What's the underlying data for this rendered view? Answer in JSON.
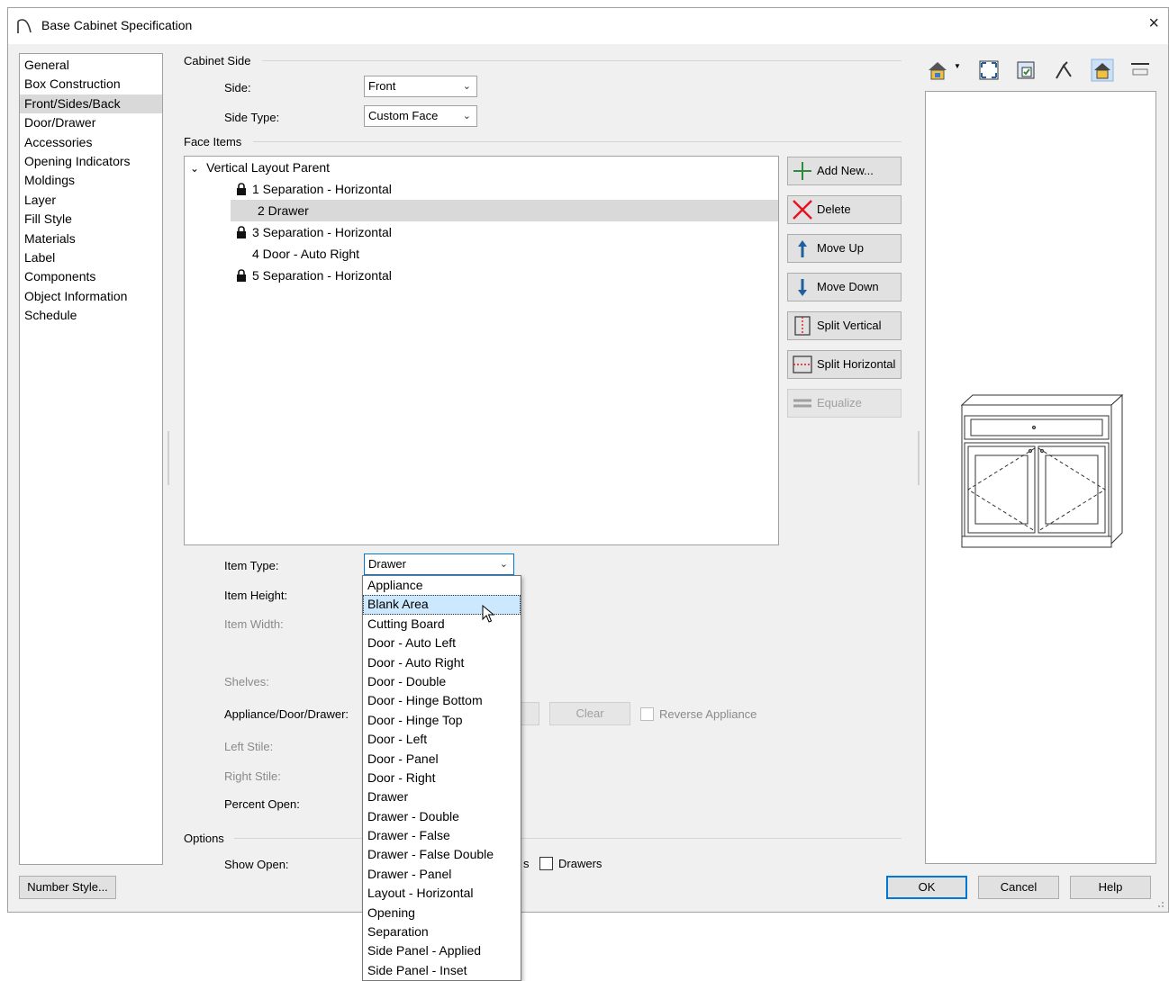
{
  "window": {
    "title": "Base Cabinet Specification",
    "close_glyph": "×"
  },
  "nav": {
    "items": [
      {
        "label": "General"
      },
      {
        "label": "Box Construction"
      },
      {
        "label": "Front/Sides/Back",
        "selected": true
      },
      {
        "label": "Door/Drawer"
      },
      {
        "label": "Accessories"
      },
      {
        "label": "Opening Indicators"
      },
      {
        "label": "Moldings"
      },
      {
        "label": "Layer"
      },
      {
        "label": "Fill Style"
      },
      {
        "label": "Materials"
      },
      {
        "label": "Label"
      },
      {
        "label": "Components"
      },
      {
        "label": "Object Information"
      },
      {
        "label": "Schedule"
      }
    ]
  },
  "cabinet_side": {
    "section": "Cabinet Side",
    "side_label": "Side:",
    "side_value": "Front",
    "side_type_label": "Side Type:",
    "side_type_value": "Custom Face"
  },
  "face_items": {
    "section": "Face Items",
    "tree": {
      "parent": "Vertical Layout Parent",
      "children": [
        {
          "label": "1 Separation - Horizontal",
          "locked": true
        },
        {
          "label": "2 Drawer",
          "locked": false,
          "selected": true
        },
        {
          "label": "3 Separation - Horizontal",
          "locked": true
        },
        {
          "label": "4 Door - Auto Right",
          "locked": false
        },
        {
          "label": "5 Separation - Horizontal",
          "locked": true
        }
      ]
    },
    "buttons": {
      "add_new": "Add New...",
      "delete": "Delete",
      "move_up": "Move Up",
      "move_down": "Move Down",
      "split_vertical": "Split Vertical",
      "split_horizontal": "Split Horizontal",
      "equalize": "Equalize"
    }
  },
  "item": {
    "type_label": "Item Type:",
    "type_value": "Drawer",
    "height_label": "Item Height:",
    "width_label": "Item Width:",
    "shelves_label": "Shelves:",
    "appliance_label": "Appliance/Door/Drawer:",
    "clear_label": "Clear",
    "reverse_appliance_label": "Reverse Appliance",
    "left_stile_label": "Left Stile:",
    "right_stile_label": "Right Stile:",
    "percent_open_label": "Percent Open:"
  },
  "options": {
    "section": "Options",
    "show_open_label": "Show Open:",
    "partial_text": "s",
    "drawers_label": "Drawers"
  },
  "dropdown": {
    "options": [
      "Appliance",
      "Blank Area",
      "Cutting Board",
      "Door - Auto Left",
      "Door - Auto Right",
      "Door - Double",
      "Door - Hinge Bottom",
      "Door - Hinge Top",
      "Door - Left",
      "Door - Panel",
      "Door - Right",
      "Drawer",
      "Drawer - Double",
      "Drawer - False",
      "Drawer - False Double",
      "Drawer - Panel",
      "Layout - Horizontal",
      "Opening",
      "Separation",
      "Side Panel - Applied",
      "Side Panel - Inset"
    ],
    "highlighted": "Blank Area"
  },
  "footer": {
    "number_style": "Number Style...",
    "ok": "OK",
    "cancel": "Cancel",
    "help": "Help"
  },
  "preview_tools": [
    "camera-view-icon",
    "fill-window-icon",
    "show-materials-icon",
    "line-drawing-icon",
    "color-icon",
    "layout-view-icon"
  ],
  "colors": {
    "accent": "#0078d7",
    "selection": "#d9d9d9",
    "highlight": "#cce8ff",
    "delete_red": "#e81123",
    "arrow_blue": "#1f5fa0",
    "add_green": "#2e8b3e"
  }
}
